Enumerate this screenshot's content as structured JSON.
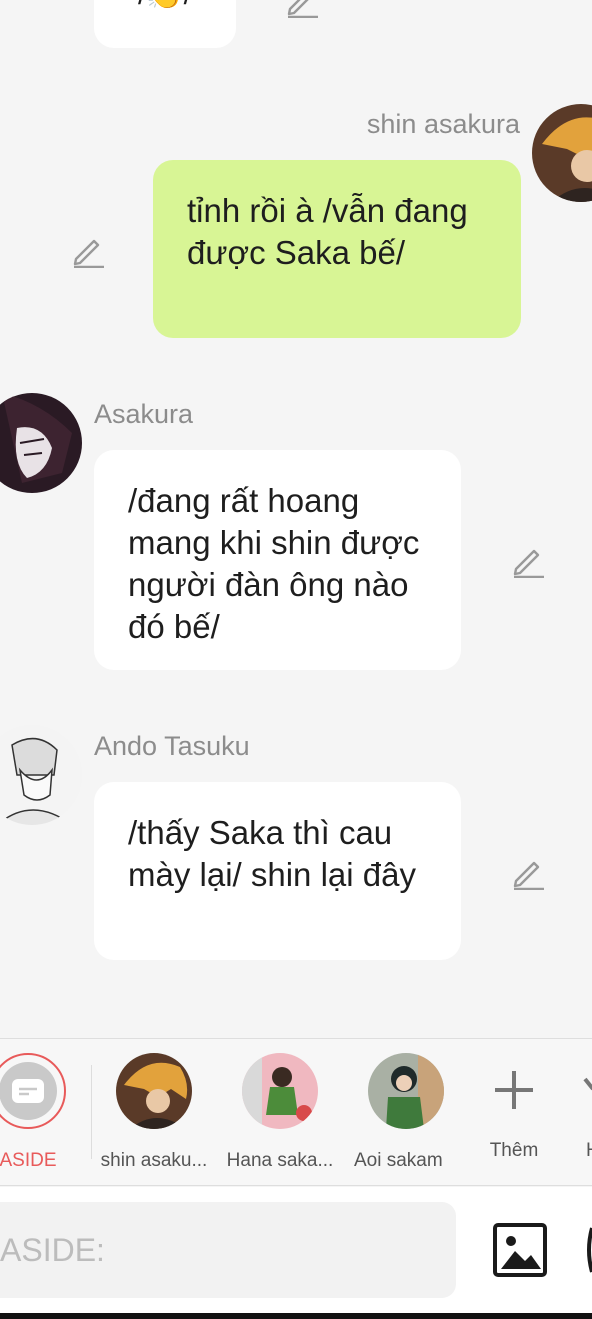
{
  "messages": [
    {
      "text": "/👏/"
    },
    {
      "sender": "shin asakura",
      "text": "tỉnh rồi à /vẫn đang được Saka bế/"
    },
    {
      "sender": "Asakura",
      "text": "/đang rất hoang mang khi shin được người đàn ông nào đó bế/"
    },
    {
      "sender": "Ando Tasuku",
      "text": "/thấy Saka thì cau mày lại/ shin lại đây"
    }
  ],
  "characters": [
    {
      "label": "ASIDE",
      "color": "#e85a5a"
    },
    {
      "label": "shin asaku..."
    },
    {
      "label": "Hana saka..."
    },
    {
      "label": "Aoi sakam"
    },
    {
      "label": "Thêm"
    },
    {
      "label": "H"
    }
  ],
  "input": {
    "placeholder": "ASIDE:"
  },
  "colors": {
    "my_bubble": "#d8f595",
    "accent": "#e85a5a",
    "background": "#f5f5f5"
  }
}
